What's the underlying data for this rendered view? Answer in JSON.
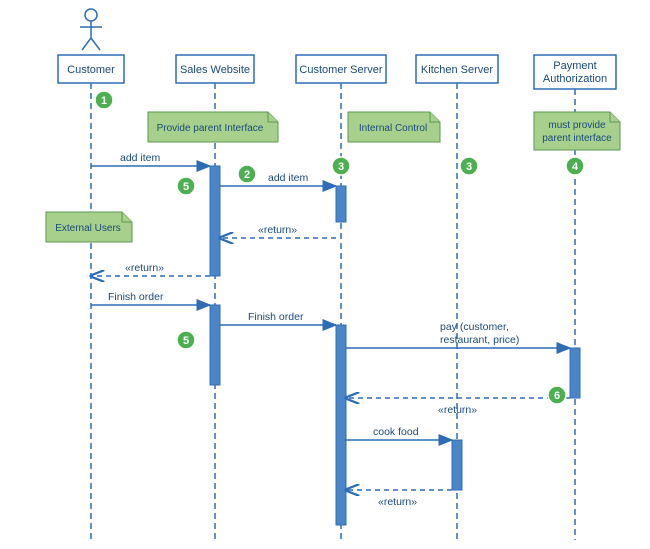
{
  "lifelines": {
    "customer": "Customer",
    "sales": "Sales Website",
    "custsrv": "Customer Server",
    "kitchen": "Kitchen Server",
    "payment_l1": "Payment",
    "payment_l2": "Authorization"
  },
  "notes": {
    "provide_parent": "Provide parent Interface",
    "internal_control": "Internal Control",
    "must_provide_l1": "must provide",
    "must_provide_l2": "parent interface",
    "external_users": "External Users"
  },
  "messages": {
    "add_item_1": "add item",
    "add_item_2": "add item",
    "return_1": "«return»",
    "return_2": "«return»",
    "finish_1": "Finish order",
    "finish_2": "Finish order",
    "pay_l1": "pay (customer,",
    "pay_l2": "restaurant, price)",
    "return_3": "«return»",
    "cook": "cook food",
    "return_4": "«return»"
  },
  "badges": {
    "b1": "1",
    "b2": "2",
    "b3a": "3",
    "b3b": "3",
    "b4": "4",
    "b5a": "5",
    "b5b": "5",
    "b6": "6"
  },
  "chart_data": {
    "type": "sequence_diagram",
    "lifelines": [
      {
        "id": "customer",
        "label": "Customer",
        "actor": true
      },
      {
        "id": "sales",
        "label": "Sales Website"
      },
      {
        "id": "custsrv",
        "label": "Customer Server"
      },
      {
        "id": "kitchen",
        "label": "Kitchen Server"
      },
      {
        "id": "payment",
        "label": "Payment Authorization"
      }
    ],
    "notes": [
      {
        "text": "Provide parent Interface",
        "near": "sales"
      },
      {
        "text": "Internal Control",
        "near": "custsrv"
      },
      {
        "text": "must provide parent interface",
        "near": "payment"
      },
      {
        "text": "External Users",
        "near": "customer"
      }
    ],
    "messages": [
      {
        "from": "customer",
        "to": "sales",
        "label": "add item",
        "type": "sync"
      },
      {
        "from": "sales",
        "to": "custsrv",
        "label": "add item",
        "type": "sync"
      },
      {
        "from": "custsrv",
        "to": "sales",
        "label": "«return»",
        "type": "return"
      },
      {
        "from": "sales",
        "to": "customer",
        "label": "«return»",
        "type": "return"
      },
      {
        "from": "customer",
        "to": "sales",
        "label": "Finish order",
        "type": "sync"
      },
      {
        "from": "sales",
        "to": "custsrv",
        "label": "Finish order",
        "type": "sync"
      },
      {
        "from": "custsrv",
        "to": "payment",
        "label": "pay (customer, restaurant, price)",
        "type": "sync"
      },
      {
        "from": "payment",
        "to": "custsrv",
        "label": "«return»",
        "type": "return"
      },
      {
        "from": "custsrv",
        "to": "kitchen",
        "label": "cook food",
        "type": "sync"
      },
      {
        "from": "kitchen",
        "to": "custsrv",
        "label": "«return»",
        "type": "return"
      }
    ],
    "numbered_badges": [
      1,
      2,
      3,
      3,
      4,
      5,
      5,
      6
    ]
  }
}
